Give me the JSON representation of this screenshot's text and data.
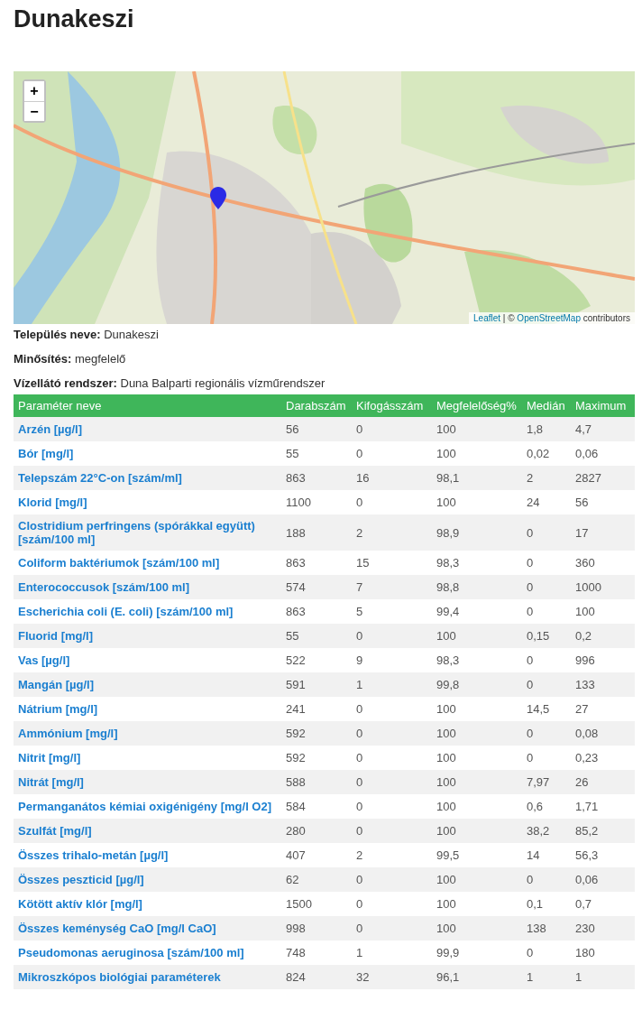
{
  "title": "Dunakeszi",
  "map": {
    "zoom_in": "+",
    "zoom_out": "−",
    "attribution": {
      "leaflet_link": "Leaflet",
      "separator": "| ©",
      "osm_link": "OpenStreetMap",
      "suffix": "contributors"
    }
  },
  "info": [
    {
      "label": "Település neve:",
      "value": "Dunakeszi"
    },
    {
      "label": "Minősítés:",
      "value": "megfelelő"
    },
    {
      "label": "Vízellátó rendszer:",
      "value": "Duna Balparti regionális vízműrendszer"
    }
  ],
  "table": {
    "columns": [
      "Paraméter neve",
      "Darabszám",
      "Kifogásszám",
      "Megfelelőség%",
      "Medián",
      "Maximum"
    ],
    "rows": [
      [
        "Arzén [µg/l]",
        "56",
        "0",
        "100",
        "1,8",
        "4,7"
      ],
      [
        "Bór [mg/l]",
        "55",
        "0",
        "100",
        "0,02",
        "0,06"
      ],
      [
        "Telepszám 22°C-on [szám/ml]",
        "863",
        "16",
        "98,1",
        "2",
        "2827"
      ],
      [
        "Klorid [mg/l]",
        "1100",
        "0",
        "100",
        "24",
        "56"
      ],
      [
        "Clostridium perfringens (spórákkal együtt) [szám/100 ml]",
        "188",
        "2",
        "98,9",
        "0",
        "17"
      ],
      [
        "Coliform baktériumok [szám/100 ml]",
        "863",
        "15",
        "98,3",
        "0",
        "360"
      ],
      [
        "Enterococcusok [szám/100 ml]",
        "574",
        "7",
        "98,8",
        "0",
        "1000"
      ],
      [
        "Escherichia coli (E. coli) [szám/100 ml]",
        "863",
        "5",
        "99,4",
        "0",
        "100"
      ],
      [
        "Fluorid [mg/l]",
        "55",
        "0",
        "100",
        "0,15",
        "0,2"
      ],
      [
        "Vas [µg/l]",
        "522",
        "9",
        "98,3",
        "0",
        "996"
      ],
      [
        "Mangán [µg/l]",
        "591",
        "1",
        "99,8",
        "0",
        "133"
      ],
      [
        "Nátrium [mg/l]",
        "241",
        "0",
        "100",
        "14,5",
        "27"
      ],
      [
        "Ammónium [mg/l]",
        "592",
        "0",
        "100",
        "0",
        "0,08"
      ],
      [
        "Nitrit [mg/l]",
        "592",
        "0",
        "100",
        "0",
        "0,23"
      ],
      [
        "Nitrát [mg/l]",
        "588",
        "0",
        "100",
        "7,97",
        "26"
      ],
      [
        "Permanganátos kémiai oxigénigény [mg/l O2]",
        "584",
        "0",
        "100",
        "0,6",
        "1,71"
      ],
      [
        "Szulfát [mg/l]",
        "280",
        "0",
        "100",
        "38,2",
        "85,2"
      ],
      [
        "Összes trihalo-metán [µg/l]",
        "407",
        "2",
        "99,5",
        "14",
        "56,3"
      ],
      [
        "Összes peszticid [µg/l]",
        "62",
        "0",
        "100",
        "0",
        "0,06"
      ],
      [
        "Kötött aktív klór [mg/l]",
        "1500",
        "0",
        "100",
        "0,1",
        "0,7"
      ],
      [
        "Összes keménység CaO [mg/l CaO]",
        "998",
        "0",
        "100",
        "138",
        "230"
      ],
      [
        "Pseudomonas aeruginosa [szám/100 ml]",
        "748",
        "1",
        "99,9",
        "0",
        "180"
      ],
      [
        "Mikroszkópos biológiai paraméterek",
        "824",
        "32",
        "96,1",
        "1",
        "1"
      ]
    ]
  }
}
